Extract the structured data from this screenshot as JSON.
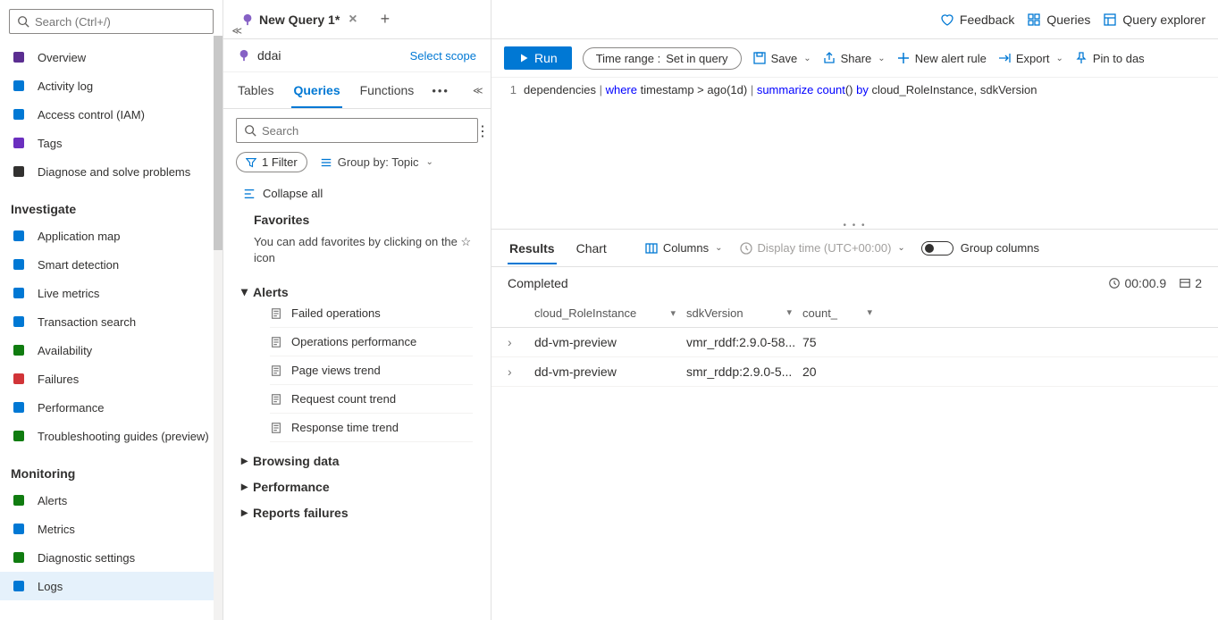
{
  "leftSidebar": {
    "searchPlaceholder": "Search (Ctrl+/)",
    "items": [
      {
        "label": "Overview",
        "icon": "globe",
        "color": "#5b2e91"
      },
      {
        "label": "Activity log",
        "icon": "log",
        "color": "#0078d4"
      },
      {
        "label": "Access control (IAM)",
        "icon": "people",
        "color": "#0078d4"
      },
      {
        "label": "Tags",
        "icon": "tag",
        "color": "#6b2fbf"
      },
      {
        "label": "Diagnose and solve problems",
        "icon": "wrench",
        "color": "#323130"
      }
    ],
    "sections": [
      {
        "title": "Investigate",
        "items": [
          {
            "label": "Application map",
            "icon": "appmap",
            "color": "#0078d4"
          },
          {
            "label": "Smart detection",
            "icon": "smart",
            "color": "#0078d4"
          },
          {
            "label": "Live metrics",
            "icon": "pulse",
            "color": "#0078d4"
          },
          {
            "label": "Transaction search",
            "icon": "search",
            "color": "#0078d4"
          },
          {
            "label": "Availability",
            "icon": "globe2",
            "color": "#107c10"
          },
          {
            "label": "Failures",
            "icon": "failures",
            "color": "#d13438"
          },
          {
            "label": "Performance",
            "icon": "perf",
            "color": "#0078d4"
          },
          {
            "label": "Troubleshooting guides (preview)",
            "icon": "book",
            "color": "#107c10"
          }
        ]
      },
      {
        "title": "Monitoring",
        "items": [
          {
            "label": "Alerts",
            "icon": "flag",
            "color": "#107c10"
          },
          {
            "label": "Metrics",
            "icon": "metrics",
            "color": "#0078d4"
          },
          {
            "label": "Diagnostic settings",
            "icon": "diag",
            "color": "#107c10"
          },
          {
            "label": "Logs",
            "icon": "logs",
            "color": "#0078d4",
            "active": true
          }
        ]
      }
    ]
  },
  "tabs": {
    "activeTab": "New Query 1*",
    "scopeName": "ddai",
    "selectScope": "Select scope"
  },
  "innerTabs": {
    "items": [
      "Tables",
      "Queries",
      "Functions"
    ],
    "active": "Queries"
  },
  "querySidebar": {
    "searchPlaceholder": "Search",
    "filterLabel": "1 Filter",
    "groupByLabel": "Group by: Topic",
    "collapseAll": "Collapse all",
    "favTitle": "Favorites",
    "favDesc": "You can add favorites by clicking on the ☆ icon",
    "tree": [
      {
        "label": "Alerts",
        "expanded": true,
        "children": [
          "Failed operations",
          "Operations performance",
          "Page views trend",
          "Request count trend",
          "Response time trend"
        ]
      },
      {
        "label": "Browsing data",
        "expanded": false
      },
      {
        "label": "Performance",
        "expanded": false
      },
      {
        "label": "Reports failures",
        "expanded": false
      }
    ]
  },
  "topActions": {
    "feedback": "Feedback",
    "queries": "Queries",
    "explorer": "Query explorer"
  },
  "toolbar": {
    "run": "Run",
    "timeRangeLabel": "Time range :",
    "timeRangeValue": "Set in query",
    "save": "Save",
    "share": "Share",
    "newAlert": "New alert rule",
    "export": "Export",
    "pin": "Pin to das"
  },
  "editor": {
    "lineNo": "1",
    "code": {
      "t1": "dependencies ",
      "p1": "|",
      "kw1": " where ",
      "t2": "timestamp > ago(",
      "lit": "1d",
      "t3": ") ",
      "p2": "|",
      "kw2": " summarize ",
      "fn": "count",
      "t4": "() ",
      "kw3": "by",
      "t5": " cloud_RoleInstance, sdkVersion"
    }
  },
  "results": {
    "tabs": [
      "Results",
      "Chart"
    ],
    "activeTab": "Results",
    "columnsBtn": "Columns",
    "displayTime": "Display time (UTC+00:00)",
    "groupCols": "Group columns",
    "status": "Completed",
    "elapsed": "00:00.9",
    "recordCount": "2",
    "headers": [
      "cloud_RoleInstance",
      "sdkVersion",
      "count_"
    ],
    "rows": [
      {
        "c1": "dd-vm-preview",
        "c2": "vmr_rddf:2.9.0-58...",
        "c3": "75"
      },
      {
        "c1": "dd-vm-preview",
        "c2": "smr_rddp:2.9.0-5...",
        "c3": "20"
      }
    ]
  }
}
